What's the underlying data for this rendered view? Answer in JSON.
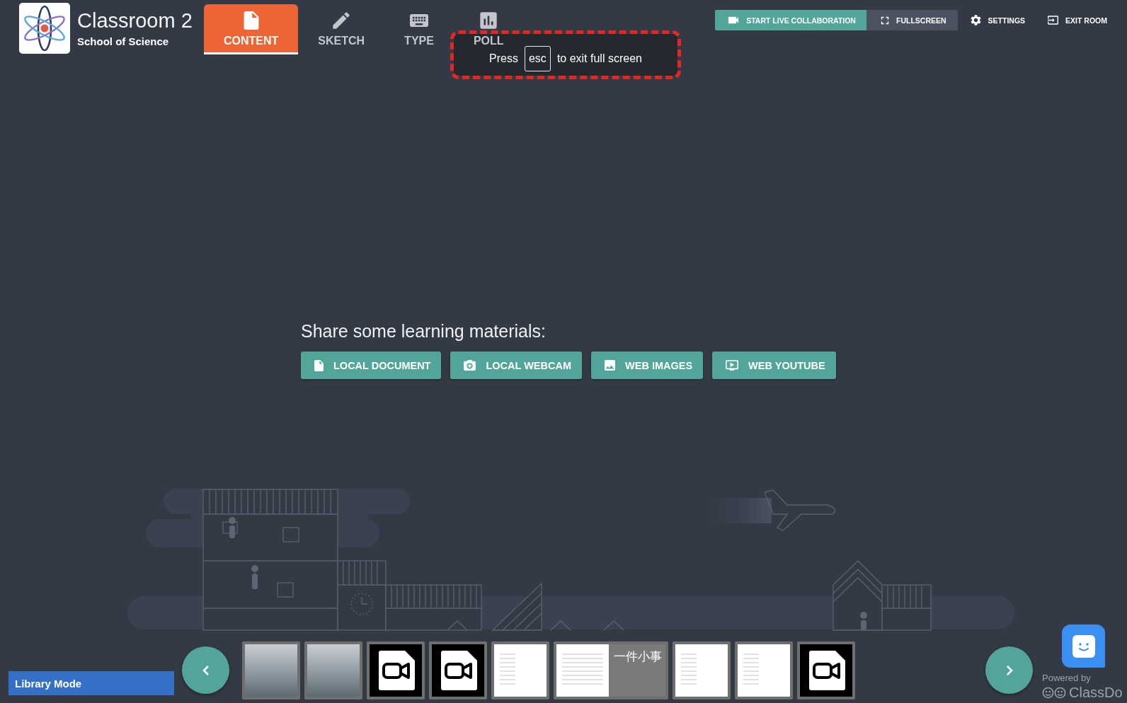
{
  "header": {
    "title": "Classroom 2",
    "subtitle": "School of Science"
  },
  "tabs": [
    {
      "label": "CONTENT",
      "selected": true
    },
    {
      "label": "SKETCH",
      "selected": false
    },
    {
      "label": "TYPE",
      "selected": false
    },
    {
      "label": "POLL",
      "selected": false
    }
  ],
  "top_actions": [
    {
      "label": "START LIVE COLLABORATION",
      "kind": "primary"
    },
    {
      "label": "FULLSCREEN",
      "kind": "secondary"
    },
    {
      "label": "SETTINGS",
      "kind": "plain"
    },
    {
      "label": "EXIT ROOM",
      "kind": "plain"
    }
  ],
  "fullscreen_notice": {
    "before": "Press",
    "key": "esc",
    "after": "to exit full screen"
  },
  "share": {
    "prompt": "Share some learning materials:",
    "buttons": [
      {
        "label": "LOCAL DOCUMENT"
      },
      {
        "label": "LOCAL WEBCAM"
      },
      {
        "label": "WEB IMAGES"
      },
      {
        "label": "WEB YOUTUBE"
      }
    ]
  },
  "library_mode": {
    "label": "Library Mode"
  },
  "thumbnails": [
    {
      "kind": "photo"
    },
    {
      "kind": "photo"
    },
    {
      "kind": "video"
    },
    {
      "kind": "video"
    },
    {
      "kind": "document"
    },
    {
      "kind": "document",
      "title": "一件小事"
    },
    {
      "kind": "document"
    },
    {
      "kind": "document"
    },
    {
      "kind": "video"
    }
  ],
  "powered_by": {
    "label": "Powered by",
    "brand": "ClassDo"
  }
}
